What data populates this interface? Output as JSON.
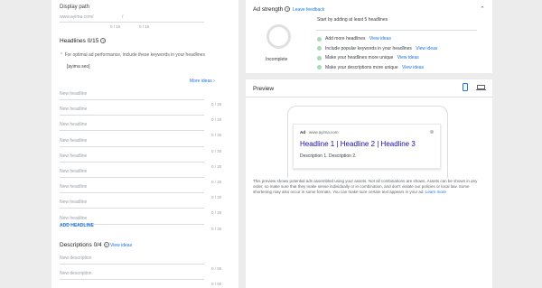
{
  "display_path": {
    "label": "Display path",
    "url": "www.ayima.com/",
    "slash": "/",
    "count1": "0 / 15",
    "count2": "0 / 15"
  },
  "headlines": {
    "title": "Headlines 0/15",
    "tip": "For optimal ad performance, include these keywords in your headlines",
    "keyword": "[ayima seo]",
    "more_ideas": "More ideas",
    "placeholder": "New headline",
    "count": "0 / 30",
    "add_label": "ADD HEADLINE"
  },
  "descriptions": {
    "title": "Descriptions 0/4",
    "view_ideas": "View ideas",
    "placeholder": "New description",
    "count": "0 / 90"
  },
  "ad_strength": {
    "title": "Ad strength",
    "feedback": "Leave feedback",
    "status": "Incomplete",
    "start_text": "Start by adding at least 5 headlines",
    "items": [
      {
        "text": "Add more headlines",
        "link": "View ideas"
      },
      {
        "text": "Include popular keywords in your headlines",
        "link": "View ideas"
      },
      {
        "text": "Make your headlines more unique",
        "link": "View ideas"
      },
      {
        "text": "Make your descriptions more unique",
        "link": "View ideas"
      }
    ]
  },
  "preview": {
    "title": "Preview",
    "ad_badge": "Ad",
    "ad_url": "· www.ayima.com",
    "ad_headline": "Headline 1 | Headline 2 | Headline 3",
    "ad_description": "Description 1. Description 2.",
    "disclaimer": "This preview shows potential ads assembled using your assets. Not all combinations are shown. Assets can be shown in any order, so make sure that they make sense individually or in combination, and don't violate our policies or local law. Some shortening may also occur in some formats. You can make sure certain text appears in your ad.",
    "learn_more": "Learn more"
  },
  "colors": {
    "accent": "#1a73e8",
    "check": "#a8dab5",
    "ring": "#e0e0e0"
  }
}
